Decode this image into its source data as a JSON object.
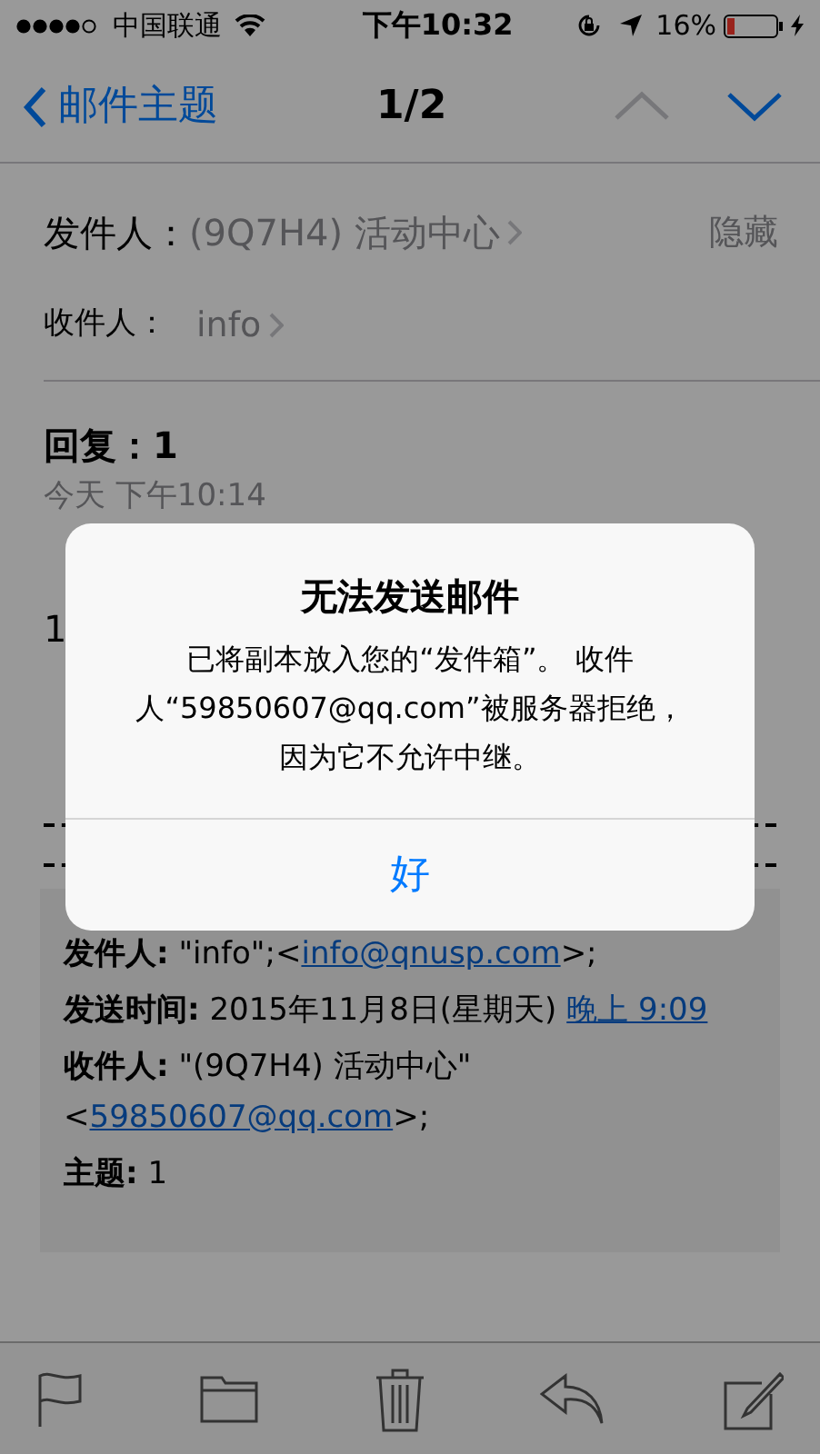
{
  "status_bar": {
    "carrier": "中国联通",
    "time": "下午10:32",
    "battery": "16%"
  },
  "nav": {
    "back": "邮件主题",
    "counter": "1/2",
    "arrows": [
      {
        "kind": "up",
        "disabled": true
      },
      {
        "kind": "down",
        "disabled": false
      }
    ]
  },
  "header": {
    "from_label": "发件人：",
    "from": "(9Q7H4) 活动中心",
    "hide": "隐藏",
    "to_label": "收件人：",
    "to": "info"
  },
  "subject": "回复：1",
  "date": "今天 下午10:14",
  "body": "1",
  "quote": [
    [
      {
        "kind": "label",
        "text": "发件人:"
      },
      {
        "kind": "text",
        "text": " \"info\";<"
      },
      {
        "kind": "link",
        "text": "info@qnusp.com"
      },
      {
        "kind": "text",
        "text": ">;"
      }
    ],
    [
      {
        "kind": "label",
        "text": "发送时间:"
      },
      {
        "kind": "text",
        "text": " 2015年11月8日(星期天) "
      },
      {
        "kind": "link",
        "text": "晚上 9:09"
      }
    ],
    [
      {
        "kind": "label",
        "text": "收件人:"
      },
      {
        "kind": "text",
        "text": " \"(9Q7H4) 活动中心\" <"
      },
      {
        "kind": "link",
        "text": "59850607@qq.com"
      },
      {
        "kind": "text",
        "text": ">;"
      }
    ],
    [
      {
        "kind": "label",
        "text": "主题:"
      },
      {
        "kind": "text",
        "text": " 1"
      }
    ]
  ],
  "toolbar": [
    {
      "kind": "flag"
    },
    {
      "kind": "folder"
    },
    {
      "kind": "trash"
    },
    {
      "kind": "reply"
    },
    {
      "kind": "compose"
    }
  ],
  "alert": {
    "title": "无法发送邮件",
    "message": "已将副本放入您的“发件箱”。 收件人“59850607@qq.com”被服务器拒绝，因为它不允许中继。",
    "button": "好"
  }
}
